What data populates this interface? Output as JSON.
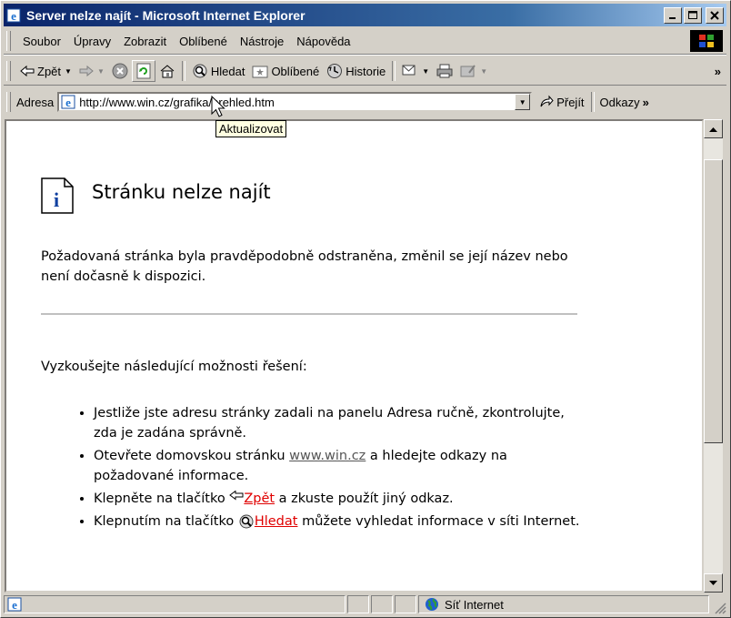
{
  "window": {
    "title": "Server nelze najít - Microsoft Internet Explorer"
  },
  "menu": [
    {
      "label": "Soubor"
    },
    {
      "label": "Úpravy"
    },
    {
      "label": "Zobrazit"
    },
    {
      "label": "Oblíbené"
    },
    {
      "label": "Nástroje"
    },
    {
      "label": "Nápověda"
    }
  ],
  "toolbar": {
    "back_label": "Zpět",
    "search_label": "Hledat",
    "favorites_label": "Oblíbené",
    "history_label": "Historie",
    "overflow": "»"
  },
  "address": {
    "label": "Adresa",
    "url": "http://www.win.cz/grafika/prehled.htm",
    "go_label": "Přejít",
    "links_label": "Odkazy",
    "overflow": "»"
  },
  "tooltip": "Aktualizovat",
  "page": {
    "heading": "Stránku nelze najít",
    "paragraph": "Požadovaná stránka byla pravděpodobně odstraněna, změnil se její název nebo není dočasně k dispozici.",
    "intro": "Vyzkoušejte následující možnosti řešení:",
    "item1": "Jestliže jste adresu stránky zadali na panelu Adresa ručně, zkontrolujte, zda je zadána správně.",
    "item2_pre": "Otevřete domovskou stránku ",
    "item2_link": "www.win.cz",
    "item2_post": " a hledejte odkazy na požadované informace.",
    "item3_pre": "Klepněte na tlačítko ",
    "item3_link": "Zpět",
    "item3_post": " a zkuste použít jiný odkaz.",
    "item4_pre": "Klepnutím na tlačítko ",
    "item4_link": "Hledat",
    "item4_post": " můžete vyhledat informace v síti Internet."
  },
  "status": {
    "zone": "Síť Internet"
  },
  "colors": {
    "titlebar_start": "#0a246a",
    "titlebar_end": "#a6caf0",
    "link_red": "#e00000"
  }
}
